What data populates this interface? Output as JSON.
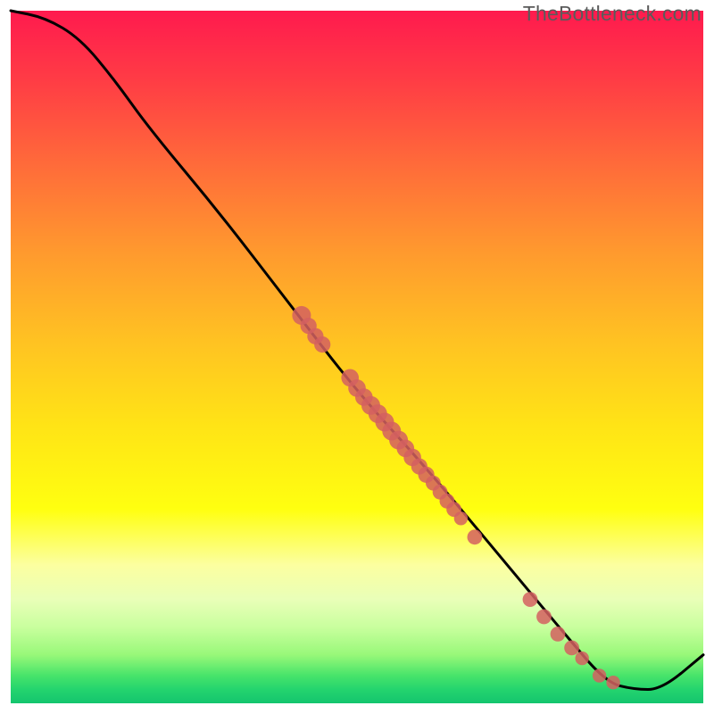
{
  "watermark": "TheBottleneck.com",
  "chart_data": {
    "type": "line",
    "title": "",
    "xlabel": "",
    "ylabel": "",
    "xlim": [
      0,
      100
    ],
    "ylim": [
      0,
      100
    ],
    "curve": [
      {
        "x": 0,
        "y": 100
      },
      {
        "x": 5,
        "y": 99
      },
      {
        "x": 10,
        "y": 96
      },
      {
        "x": 15,
        "y": 90
      },
      {
        "x": 20,
        "y": 83
      },
      {
        "x": 30,
        "y": 71
      },
      {
        "x": 40,
        "y": 58
      },
      {
        "x": 50,
        "y": 45
      },
      {
        "x": 60,
        "y": 34
      },
      {
        "x": 70,
        "y": 22
      },
      {
        "x": 80,
        "y": 10
      },
      {
        "x": 86,
        "y": 3
      },
      {
        "x": 90,
        "y": 2
      },
      {
        "x": 94,
        "y": 2
      },
      {
        "x": 100,
        "y": 7
      }
    ],
    "points": [
      {
        "x": 42,
        "y": 56,
        "r": 1.5
      },
      {
        "x": 43,
        "y": 54.5,
        "r": 1.3
      },
      {
        "x": 44,
        "y": 53,
        "r": 1.3
      },
      {
        "x": 45,
        "y": 51.8,
        "r": 1.3
      },
      {
        "x": 49,
        "y": 47,
        "r": 1.4
      },
      {
        "x": 50,
        "y": 45.5,
        "r": 1.4
      },
      {
        "x": 51,
        "y": 44.2,
        "r": 1.4
      },
      {
        "x": 52,
        "y": 43.0,
        "r": 1.5
      },
      {
        "x": 53,
        "y": 41.8,
        "r": 1.5
      },
      {
        "x": 54,
        "y": 40.6,
        "r": 1.5
      },
      {
        "x": 55,
        "y": 39.3,
        "r": 1.5
      },
      {
        "x": 56,
        "y": 38.0,
        "r": 1.5
      },
      {
        "x": 57,
        "y": 36.8,
        "r": 1.4
      },
      {
        "x": 58,
        "y": 35.5,
        "r": 1.4
      },
      {
        "x": 59,
        "y": 34.2,
        "r": 1.3
      },
      {
        "x": 60,
        "y": 33.0,
        "r": 1.3
      },
      {
        "x": 61,
        "y": 31.8,
        "r": 1.2
      },
      {
        "x": 62,
        "y": 30.5,
        "r": 1.2
      },
      {
        "x": 63,
        "y": 29.2,
        "r": 1.2
      },
      {
        "x": 64,
        "y": 28.0,
        "r": 1.2
      },
      {
        "x": 65,
        "y": 26.7,
        "r": 1.1
      },
      {
        "x": 67,
        "y": 24,
        "r": 1.2
      },
      {
        "x": 75,
        "y": 15,
        "r": 1.2
      },
      {
        "x": 77,
        "y": 12.5,
        "r": 1.2
      },
      {
        "x": 79,
        "y": 10,
        "r": 1.2
      },
      {
        "x": 81,
        "y": 8,
        "r": 1.2
      },
      {
        "x": 82.5,
        "y": 6.5,
        "r": 1.1
      },
      {
        "x": 85,
        "y": 4,
        "r": 1.1
      },
      {
        "x": 87,
        "y": 3,
        "r": 1.1
      }
    ],
    "colors": {
      "curve": "#000000",
      "points": "#d36060"
    }
  }
}
